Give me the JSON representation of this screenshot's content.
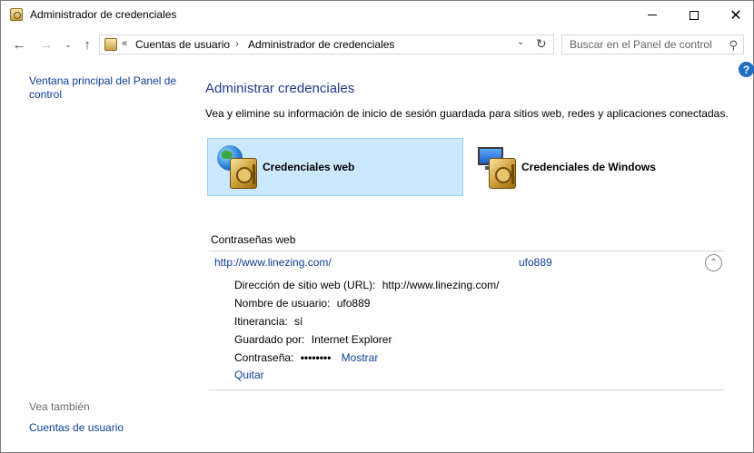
{
  "window": {
    "title": "Administrador de credenciales",
    "minimize": "–",
    "maximize": "□",
    "close": "✕"
  },
  "nav": {
    "back": "←",
    "forward": "→",
    "recent": "⌄",
    "up": "↑",
    "address": {
      "chevron": "«",
      "crumbs": [
        "Cuentas de usuario",
        "Administrador de credenciales"
      ],
      "separator": "›",
      "dropdown": "⌄",
      "refresh": "↻"
    },
    "search": {
      "placeholder": "Buscar en el Panel de control",
      "icon": "⚲"
    }
  },
  "help": "?",
  "sidebar": {
    "main_link": "Ventana principal del Panel de control",
    "see_also": "Vea también",
    "user_accounts": "Cuentas de usuario"
  },
  "main": {
    "title": "Administrar credenciales",
    "description": "Vea y elimine su información de inicio de sesión guardada para sitios web, redes y aplicaciones conectadas.",
    "tiles": [
      {
        "label": "Credenciales web",
        "selected": true
      },
      {
        "label": "Credenciales de Windows",
        "selected": false
      }
    ],
    "section_title": "Contraseñas web",
    "credential": {
      "url": "http://www.linezing.com/",
      "user": "ufo889",
      "collapse": "⌃",
      "details": {
        "site_label": "Dirección de sitio web (URL):",
        "site_value": "http://www.linezing.com/",
        "user_label": "Nombre de usuario:",
        "user_value": "ufo889",
        "roaming_label": "Itinerancia:",
        "roaming_value": "sí",
        "saved_by_label": "Guardado por:",
        "saved_by_value": "Internet Explorer",
        "password_label": "Contraseña:",
        "password_value": "••••••••",
        "show": "Mostrar",
        "remove": "Quitar"
      }
    }
  }
}
